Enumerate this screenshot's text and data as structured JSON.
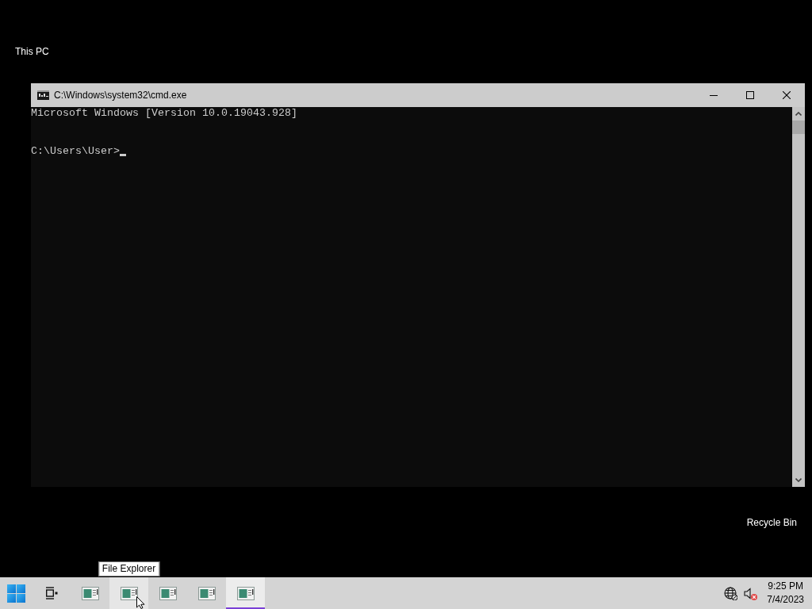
{
  "desktop": {
    "icons": [
      {
        "label": "This PC"
      },
      {
        "label": "Recycle Bin"
      }
    ]
  },
  "window": {
    "title": "C:\\Windows\\system32\\cmd.exe",
    "console": {
      "output": [
        "Microsoft Windows [Version 10.0.19043.928]"
      ],
      "prompt": "C:\\Users\\User>"
    }
  },
  "taskbar": {
    "apps": [
      {
        "selected": false,
        "hovered": false
      },
      {
        "selected": false,
        "hovered": true,
        "tooltip": "File Explorer"
      },
      {
        "selected": false,
        "hovered": false
      },
      {
        "selected": false,
        "hovered": false
      },
      {
        "selected": true,
        "hovered": false
      }
    ],
    "clock": {
      "time": "9:25 PM",
      "date": "7/4/2023"
    }
  }
}
